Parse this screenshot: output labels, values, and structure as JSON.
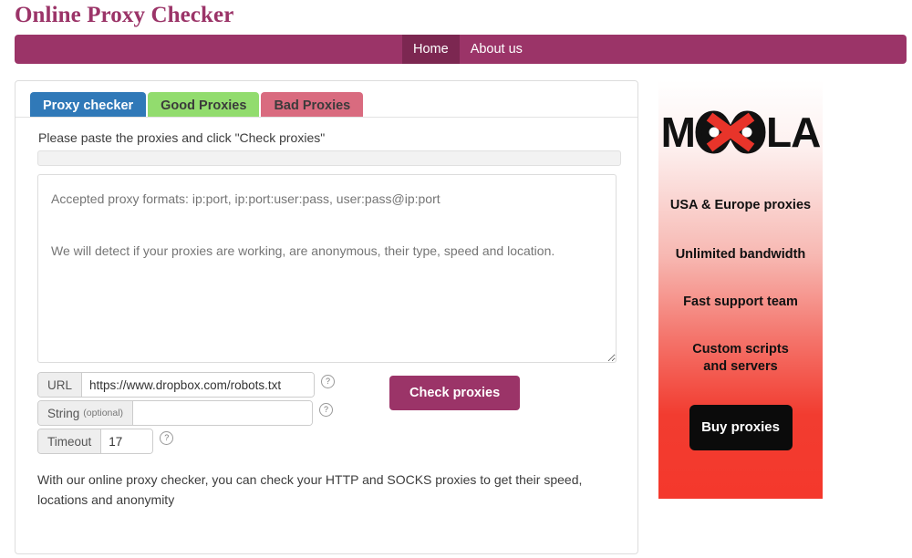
{
  "site": {
    "title": "Online Proxy Checker",
    "brand_color": "#9B3468"
  },
  "nav": {
    "items": [
      {
        "label": "Home",
        "active": true
      },
      {
        "label": "About us",
        "active": false
      }
    ]
  },
  "tabs": [
    {
      "label": "Proxy checker",
      "state": "active",
      "color": "#3079B8"
    },
    {
      "label": "Good Proxies",
      "state": "inactive",
      "color": "#92DC6E"
    },
    {
      "label": "Bad Proxies",
      "state": "inactive",
      "color": "#D96B7F"
    }
  ],
  "main": {
    "instruction": "Please paste the proxies and click \"Check proxies\"",
    "progress_percent": 0,
    "textarea": {
      "value": "",
      "placeholder_line_1": "Accepted proxy formats: ip:port, ip:port:user:pass, user:pass@ip:port",
      "placeholder_line_2": "We will detect if your proxies are working, are anonymous, their type, speed and location."
    },
    "fields": [
      {
        "label": "URL",
        "label_suffix": "",
        "value": "https://www.dropbox.com/robots.txt",
        "placeholder": "",
        "help_icon": "help-circle-icon"
      },
      {
        "label": "String",
        "label_suffix": "(optional)",
        "value": "",
        "placeholder": "",
        "help_icon": "help-circle-icon"
      },
      {
        "label": "Timeout",
        "label_suffix": "",
        "value": "17",
        "placeholder": "",
        "help_icon": "help-circle-icon"
      }
    ],
    "submit_label": "Check proxies",
    "description": "With our online proxy checker, you can check your HTTP and SOCKS proxies to get their speed, locations and anonymity"
  },
  "ad": {
    "logo": {
      "left_letter": "M",
      "symbol": "infinity-x-icon",
      "right_letters": "LA",
      "full_text": "MOOLA"
    },
    "lines": [
      "USA & Europe proxies",
      "Unlimited bandwidth",
      "Fast support team",
      "Custom scripts",
      "and servers"
    ],
    "button_label": "Buy proxies",
    "accent_color": "#F23C30"
  }
}
